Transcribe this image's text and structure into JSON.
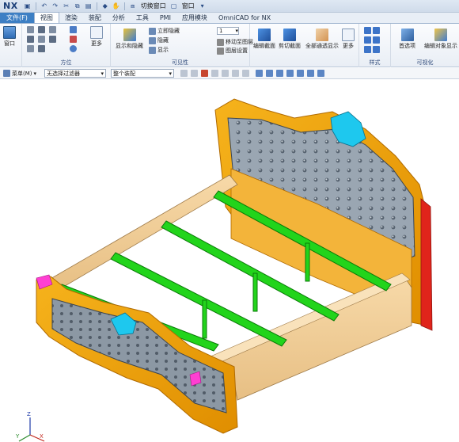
{
  "app": {
    "logo": "NX"
  },
  "quick_access": {
    "switch_window": "切换窗口",
    "window": "窗口"
  },
  "tabs": [
    "文件(F)",
    "视图",
    "渲染",
    "装配",
    "分析",
    "工具",
    "PMI",
    "应用模块",
    "OmniCAD for NX"
  ],
  "ribbon": {
    "window_label": "窗口",
    "more_label": "更多",
    "orientation_group": "方位",
    "show_hide": "显示和隐藏",
    "immediate_hide": "立即隐藏",
    "hide": "隐藏",
    "show": "显示",
    "layer_value": "1",
    "move_to_layer": "移动至图层",
    "layer_settings": "图层设置",
    "visibility_group": "可见性",
    "edit_section": "编辑截面",
    "cut_section": "剪切截面",
    "all_transparent": "全部通透显示",
    "more2": "更多",
    "style_group": "样式",
    "preferences": "首选项",
    "edit_object_display": "编辑对象显示",
    "visualization_group": "可视化"
  },
  "selection_bar": {
    "menu_label": "菜单(M)",
    "filter_value": "无选择过滤器",
    "scope_value": "整个装配"
  },
  "colors": {
    "wood": "#f4c98a",
    "green_rail": "#20d21a",
    "gold_trim": "#f2a400",
    "tufted_panel": "#8e9ca8",
    "carving": "#1ec8ee"
  },
  "axis": {
    "z": "Z",
    "x": "X",
    "y": "Y"
  }
}
